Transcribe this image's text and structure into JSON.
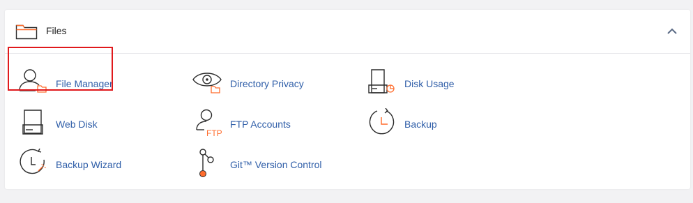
{
  "section": {
    "title": "Files",
    "icon": "folder-icon",
    "collapse_icon": "chevron-up-icon"
  },
  "items": [
    {
      "label": "File Manager",
      "icon": "file-manager-icon",
      "highlighted": true
    },
    {
      "label": "Directory Privacy",
      "icon": "directory-privacy-icon"
    },
    {
      "label": "Disk Usage",
      "icon": "disk-usage-icon"
    },
    {
      "label": "Web Disk",
      "icon": "web-disk-icon"
    },
    {
      "label": "FTP Accounts",
      "icon": "ftp-accounts-icon",
      "icon_text": "FTP"
    },
    {
      "label": "Backup",
      "icon": "backup-icon"
    },
    {
      "label": "Backup Wizard",
      "icon": "backup-wizard-icon"
    },
    {
      "label": "Git™ Version Control",
      "icon": "git-version-control-icon"
    }
  ],
  "colors": {
    "link": "#2f5ea8",
    "accent": "#ff6c2c",
    "icon_stroke": "#2b2b2b",
    "highlight": "#e0191c"
  }
}
